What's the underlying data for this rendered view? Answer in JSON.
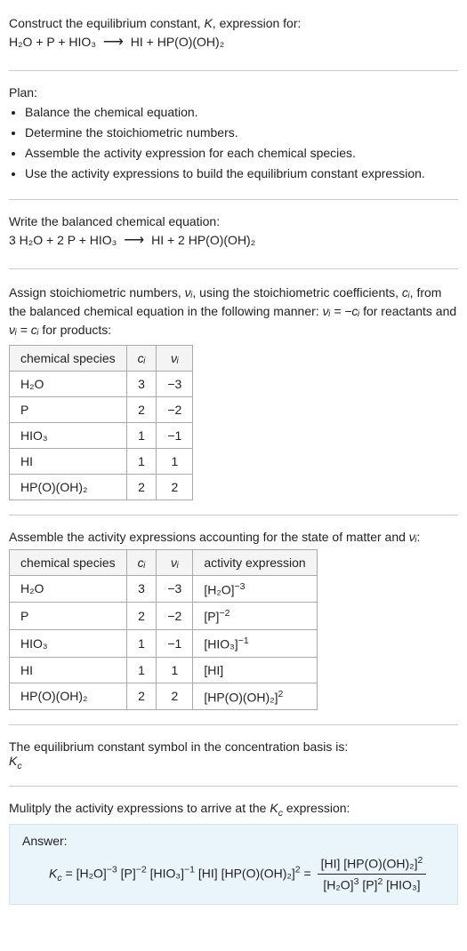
{
  "intro": {
    "line1": "Construct the equilibrium constant, ",
    "K": "K",
    "line1b": ", expression for:",
    "eq_lhs": "H₂O + P + HIO₃",
    "eq_rhs": "HI + HP(O)(OH)₂"
  },
  "plan": {
    "heading": "Plan:",
    "items": [
      "Balance the chemical equation.",
      "Determine the stoichiometric numbers.",
      "Assemble the activity expression for each chemical species.",
      "Use the activity expressions to build the equilibrium constant expression."
    ]
  },
  "balanced": {
    "heading": "Write the balanced chemical equation:",
    "lhs": "3 H₂O + 2 P + HIO₃",
    "rhs": "HI + 2 HP(O)(OH)₂"
  },
  "stoich": {
    "text_a": "Assign stoichiometric numbers, ",
    "nu": "νᵢ",
    "text_b": ", using the stoichiometric coefficients, ",
    "ci": "cᵢ",
    "text_c": ", from the balanced chemical equation in the following manner: ",
    "rel1": "νᵢ = −cᵢ",
    "text_d": " for reactants and ",
    "rel2": "νᵢ = cᵢ",
    "text_e": " for products:",
    "headers": [
      "chemical species",
      "cᵢ",
      "νᵢ"
    ],
    "rows": [
      [
        "H₂O",
        "3",
        "−3"
      ],
      [
        "P",
        "2",
        "−2"
      ],
      [
        "HIO₃",
        "1",
        "−1"
      ],
      [
        "HI",
        "1",
        "1"
      ],
      [
        "HP(O)(OH)₂",
        "2",
        "2"
      ]
    ]
  },
  "activity": {
    "text_a": "Assemble the activity expressions accounting for the state of matter and ",
    "nu": "νᵢ",
    "text_b": ":",
    "headers": [
      "chemical species",
      "cᵢ",
      "νᵢ",
      "activity expression"
    ],
    "rows": [
      {
        "sp": "H₂O",
        "c": "3",
        "v": "−3",
        "expr_base": "[H₂O]",
        "expr_sup": "−3"
      },
      {
        "sp": "P",
        "c": "2",
        "v": "−2",
        "expr_base": "[P]",
        "expr_sup": "−2"
      },
      {
        "sp": "HIO₃",
        "c": "1",
        "v": "−1",
        "expr_base": "[HIO₃]",
        "expr_sup": "−1"
      },
      {
        "sp": "HI",
        "c": "1",
        "v": "1",
        "expr_base": "[HI]",
        "expr_sup": ""
      },
      {
        "sp": "HP(O)(OH)₂",
        "c": "2",
        "v": "2",
        "expr_base": "[HP(O)(OH)₂]",
        "expr_sup": "2"
      }
    ]
  },
  "eqconst": {
    "line1": "The equilibrium constant symbol in the concentration basis is:",
    "symbol": "K",
    "sub": "c"
  },
  "final": {
    "line1_a": "Mulitply the activity expressions to arrive at the ",
    "Kc": "K",
    "Kc_sub": "c",
    "line1_b": " expression:",
    "answer_label": "Answer:",
    "lhs_K": "K",
    "lhs_sub": "c",
    "expr_flat_1": "[H₂O]",
    "sup1": "−3",
    "expr_flat_2": "[P]",
    "sup2": "−2",
    "expr_flat_3": "[HIO₃]",
    "sup3": "−1",
    "expr_flat_4": "[HI]",
    "expr_flat_5": "[HP(O)(OH)₂]",
    "sup5": "2",
    "frac_num_1": "[HI]",
    "frac_num_2": "[HP(O)(OH)₂]",
    "frac_num_sup2": "2",
    "frac_den_1": "[H₂O]",
    "frac_den_sup1": "3",
    "frac_den_2": "[P]",
    "frac_den_sup2": "2",
    "frac_den_3": "[HIO₃]"
  }
}
